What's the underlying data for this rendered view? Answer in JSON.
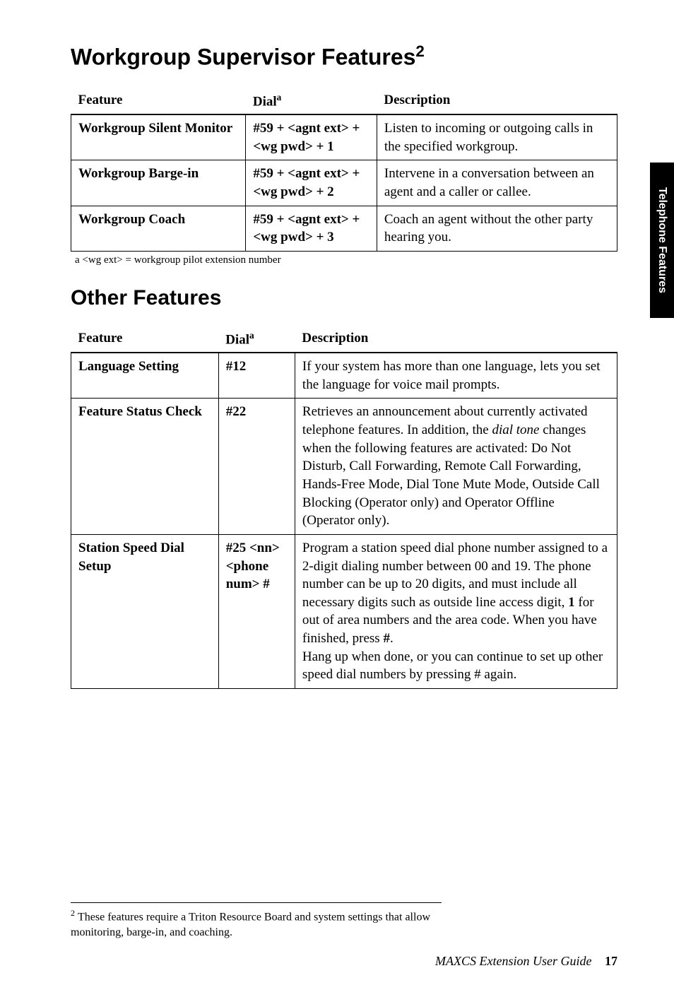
{
  "heading1": "Workgroup Supervisor Features",
  "heading1_sup": "2",
  "table1": {
    "headers": [
      "Feature",
      "Dial",
      "Description"
    ],
    "dial_sup": "a",
    "rows": [
      {
        "feature": "Workgroup Silent Monitor",
        "dial": "#59 + <agnt ext> +<wg pwd> + 1",
        "desc": "Listen to incoming or outgoing calls in the specified workgroup."
      },
      {
        "feature": "Workgroup Barge-in",
        "dial": "#59 + <agnt ext> +<wg pwd> + 2",
        "desc": "Intervene in a conversation between an agent and a caller or callee."
      },
      {
        "feature": "Workgroup Coach",
        "dial": "#59 + <agnt ext> +<wg pwd> + 3",
        "desc": "Coach an agent without the other party hearing you."
      }
    ],
    "footnote": "a <wg ext> = workgroup pilot extension number"
  },
  "heading2": "Other Features",
  "table2": {
    "headers": [
      "Feature",
      "Dial",
      "Description"
    ],
    "dial_sup": "a",
    "rows": [
      {
        "feature": "Language Setting",
        "dial": "#12",
        "desc_html": "If your system has more than one language, lets you set the language for voice mail prompts."
      },
      {
        "feature": "Feature Status Check",
        "dial": "#22",
        "desc_html": "Retrieves an announcement about currently activated telephone features. In addition, the <span class=\"italic\">dial tone</span> changes when the following features are activated: Do Not Disturb, Call Forwarding, Remote Call Forwarding, Hands-Free Mode, Dial Tone Mute Mode, Outside Call Blocking (Operator only) and Operator Offline (Operator only)."
      },
      {
        "feature": "Station Speed Dial Setup",
        "dial": "#25 <nn> <phone num> #",
        "desc_html": "Program a station speed dial phone number assigned to a 2-digit dialing number between 00 and 19. The phone number can be up to 20 digits, and must include all necessary digits such as outside line access digit, <b>1</b> for out of area numbers and the area code. When you have finished, press <b>#</b>.<br>Hang up when done, or you can continue to set up other speed dial numbers by pressing # again."
      }
    ]
  },
  "footnote2": "These features require a Triton Resource Board and system settings that allow monitoring, barge-in, and coaching.",
  "footnote2_num": "2",
  "side_tab": "Telephone Features",
  "footer_guide": "MAXCS Extension User Guide",
  "footer_page": "17"
}
